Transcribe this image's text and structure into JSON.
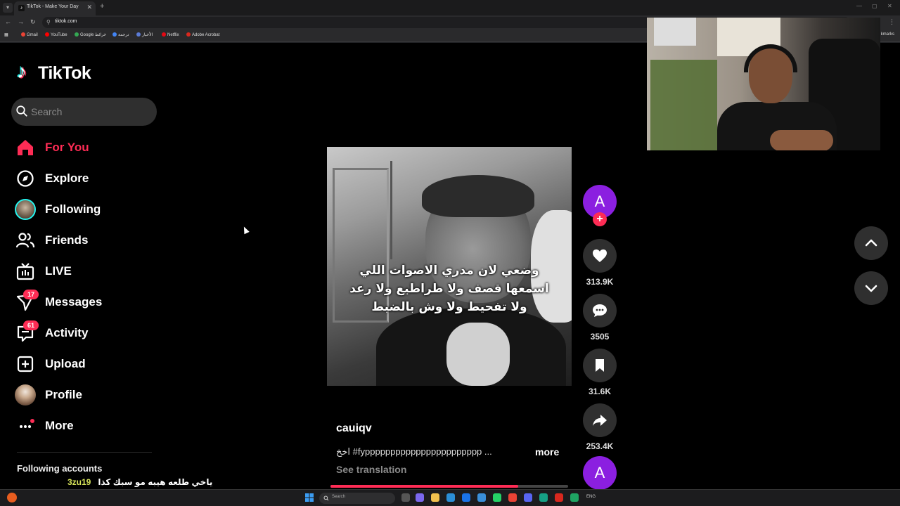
{
  "browser": {
    "tab_title": "TikTok - Make Your Day",
    "url": "tiktok.com",
    "bookmarks": [
      {
        "label": "Gmail",
        "color": "#ea4335"
      },
      {
        "label": "YouTube",
        "color": "#ff0000"
      },
      {
        "label": "Google خرائط",
        "color": "#34a853"
      },
      {
        "label": "ترجمة",
        "color": "#4285f4"
      },
      {
        "label": "الأخبار",
        "color": "#5b7bd5"
      },
      {
        "label": "Netflix",
        "color": "#e50914"
      },
      {
        "label": "Adobe Acrobat",
        "color": "#d9281e"
      }
    ],
    "bookmarks_right": "kmarks"
  },
  "app": {
    "logo_text": "TikTok",
    "accent": "#fe2c55"
  },
  "search": {
    "placeholder": "Search"
  },
  "nav": {
    "items": [
      {
        "label": "For You",
        "icon": "home-icon",
        "active": true
      },
      {
        "label": "Explore",
        "icon": "compass-icon"
      },
      {
        "label": "Following",
        "icon": "following-avatar"
      },
      {
        "label": "Friends",
        "icon": "friends-icon"
      },
      {
        "label": "LIVE",
        "icon": "live-icon"
      },
      {
        "label": "Messages",
        "icon": "messages-icon",
        "badge": "17"
      },
      {
        "label": "Activity",
        "icon": "activity-icon",
        "badge": "61"
      },
      {
        "label": "Upload",
        "icon": "upload-icon"
      },
      {
        "label": "Profile",
        "icon": "profile-avatar"
      },
      {
        "label": "More",
        "icon": "more-icon"
      }
    ]
  },
  "sidebar_footer": {
    "following_accounts": "Following accounts"
  },
  "stream_chat": {
    "user": "3zu19",
    "message": "ياخي طلعه هيبه مو سبك كذا"
  },
  "video": {
    "caption_lines": [
      "وضعي لان مدري الاصوات اللي",
      "اسمعها قصف ولا طراطيع ولا رعد",
      "ولا تفحيط ولا وش بالضبط"
    ],
    "progress": 0.79
  },
  "post": {
    "author": "cauiqv",
    "description": "اخخ #fyppppppppppppppppppppppp ...",
    "more_label": "more",
    "see_translation": "See translation"
  },
  "actions": {
    "avatar_letter": "A",
    "likes": "313.9K",
    "comments": "3505",
    "saves": "31.6K",
    "shares": "253.4K"
  },
  "taskbar": {
    "search_placeholder": "Search"
  }
}
